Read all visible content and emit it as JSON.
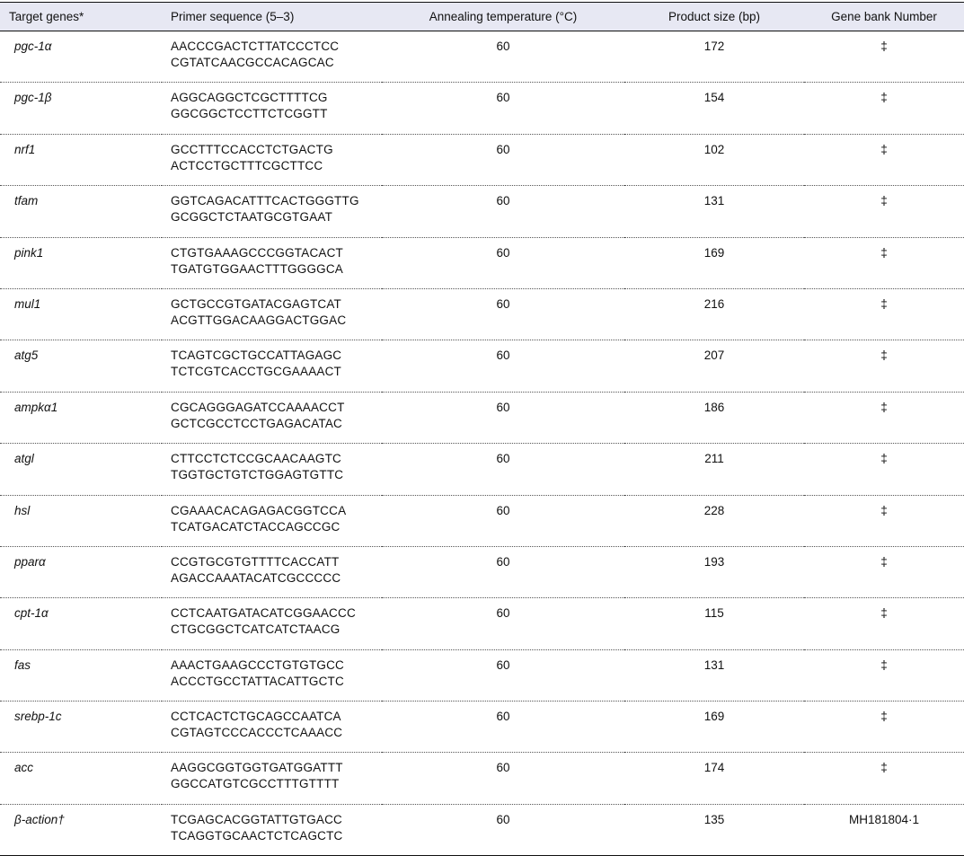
{
  "headers": [
    "Target genes*",
    "Primer sequence (5–3)",
    "Annealing temperature (°C)",
    "Product size (bp)",
    "Gene bank Number"
  ],
  "rows": [
    {
      "gene": "pgc-1α",
      "fwd": "AACCCGACTCTTATCCCTCC",
      "rev": "CGTATCAACGCCACAGCAC",
      "temp": "60",
      "size": "172",
      "bank": "‡"
    },
    {
      "gene": "pgc-1β",
      "fwd": "AGGCAGGCTCGCTTTTCG",
      "rev": "GGCGGCTCCTTCTCGGTT",
      "temp": "60",
      "size": "154",
      "bank": "‡"
    },
    {
      "gene": "nrf1",
      "fwd": "GCCTTTCCACCTCTGACTG",
      "rev": "ACTCCTGCTTTCGCTTCC",
      "temp": "60",
      "size": "102",
      "bank": "‡"
    },
    {
      "gene": "tfam",
      "fwd": "GGTCAGACATTTCACTGGGTTG",
      "rev": "GCGGCTCTAATGCGTGAAT",
      "temp": "60",
      "size": "131",
      "bank": "‡"
    },
    {
      "gene": "pink1",
      "fwd": "CTGTGAAAGCCCGGTACACT",
      "rev": "TGATGTGGAACTTTGGGGCA",
      "temp": "60",
      "size": "169",
      "bank": "‡"
    },
    {
      "gene": "mul1",
      "fwd": "GCTGCCGTGATACGAGTCAT",
      "rev": "ACGTTGGACAAGGACTGGAC",
      "temp": "60",
      "size": "216",
      "bank": "‡"
    },
    {
      "gene": "atg5",
      "fwd": "TCAGTCGCTGCCATTAGAGC",
      "rev": "TCTCGTCACCTGCGAAAACT",
      "temp": "60",
      "size": "207",
      "bank": "‡"
    },
    {
      "gene": "ampkα1",
      "fwd": "CGCAGGGAGATCCAAAACCT",
      "rev": "GCTCGCCTCCTGAGACATAC",
      "temp": "60",
      "size": "186",
      "bank": "‡"
    },
    {
      "gene": "atgl",
      "fwd": "CTTCCTCTCCGCAACAAGTC",
      "rev": "TGGTGCTGTCTGGAGTGTTC",
      "temp": "60",
      "size": "211",
      "bank": "‡"
    },
    {
      "gene": "hsl",
      "fwd": "CGAAACACAGAGACGGTCCA",
      "rev": "TCATGACATCTACCAGCCGC",
      "temp": "60",
      "size": "228",
      "bank": "‡"
    },
    {
      "gene": "pparα",
      "fwd": "CCGTGCGTGTTTTCACCATT",
      "rev": "AGACCAAATACATCGCCCCC",
      "temp": "60",
      "size": "193",
      "bank": "‡"
    },
    {
      "gene": "cpt-1α",
      "fwd": "CCTCAATGATACATCGGAACCC",
      "rev": "CTGCGGCTCATCATCTAACG",
      "temp": "60",
      "size": "115",
      "bank": "‡"
    },
    {
      "gene": "fas",
      "fwd": "AAACTGAAGCCCTGTGTGCC",
      "rev": "ACCCTGCCTATTACATTGCTC",
      "temp": "60",
      "size": "131",
      "bank": "‡"
    },
    {
      "gene": "srebp-1c",
      "fwd": "CCTCACTCTGCAGCCAATCA",
      "rev": "CGTAGTCCCACCCTCAAACC",
      "temp": "60",
      "size": "169",
      "bank": "‡"
    },
    {
      "gene": "acc",
      "fwd": "AAGGCGGTGGTGATGGATTT",
      "rev": "GGCCATGTCGCCTTTGTTTT",
      "temp": "60",
      "size": "174",
      "bank": "‡"
    },
    {
      "gene": "β-action†",
      "fwd": "TCGAGCACGGTATTGTGACC",
      "rev": "TCAGGTGCAACTCTCAGCTC",
      "temp": "60",
      "size": "135",
      "bank": "MH181804·1"
    }
  ]
}
